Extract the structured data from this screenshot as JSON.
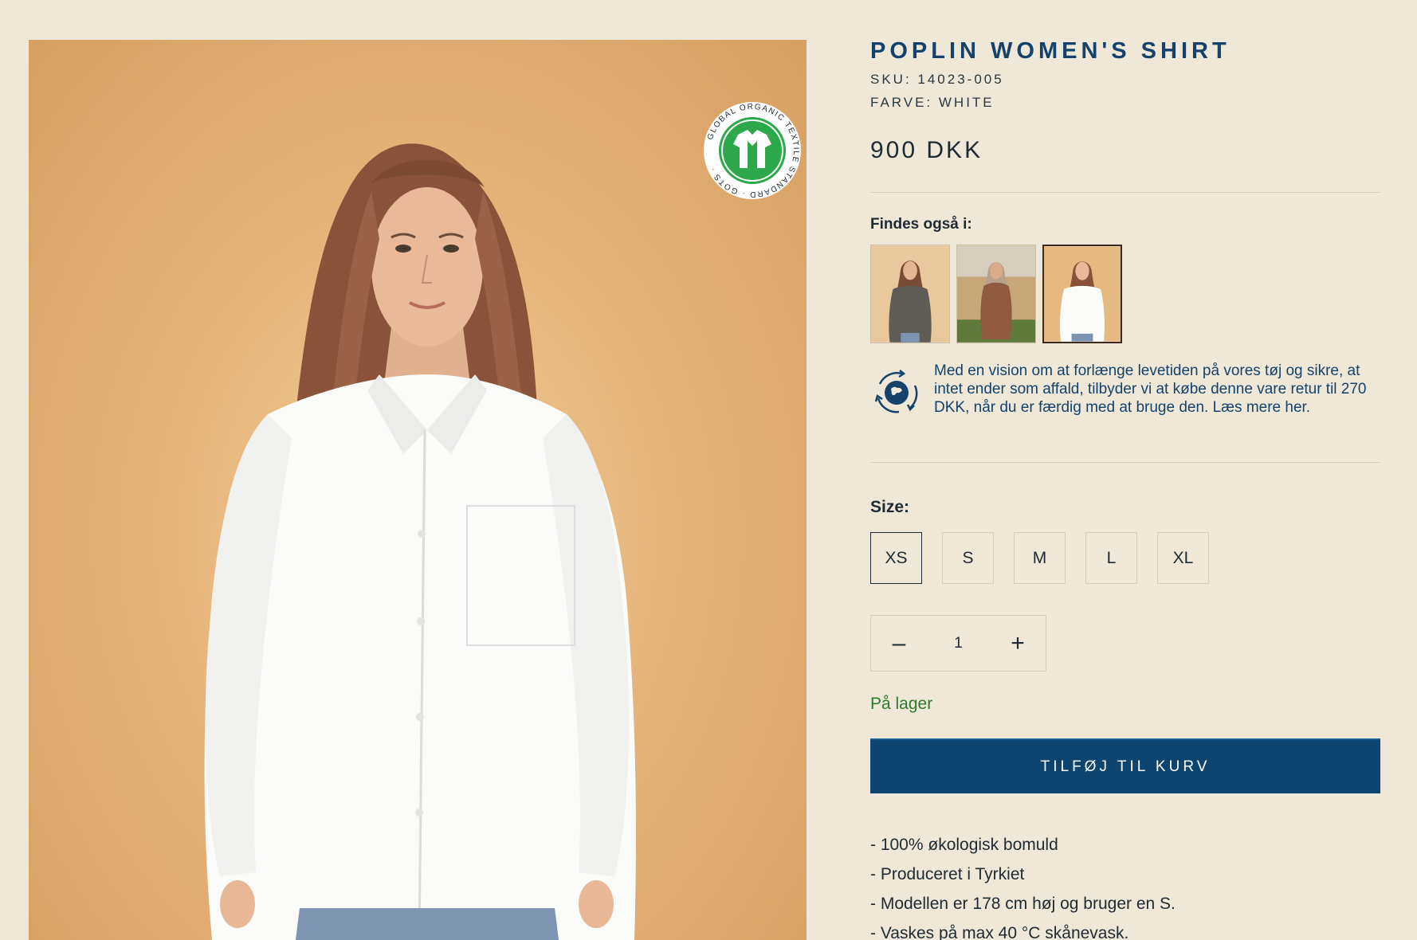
{
  "product": {
    "title": "POPLIN WOMEN'S SHIRT",
    "sku": "SKU: 14023-005",
    "color": "FARVE: WHITE",
    "price": "900 DKK"
  },
  "badge": {
    "text": "GLOBAL ORGANIC TEXTILE STANDARD · GOTS ·",
    "icon": "gots-shirt-icon"
  },
  "variants": {
    "label": "Findes også i:",
    "items": [
      {
        "name": "variant-grey-shirt",
        "active": false
      },
      {
        "name": "variant-brown-shirt",
        "active": false
      },
      {
        "name": "variant-white-shirt",
        "active": true
      }
    ]
  },
  "buyback": {
    "icon": "recycle-globe-icon",
    "text": "Med en vision om at forlænge levetiden på vores tøj og sikre, at intet ender som affald, tilbyder vi at købe denne vare retur til 270 DKK, når du er færdig med at bruge den. Læs mere her."
  },
  "size": {
    "label": "Size:",
    "options": [
      "XS",
      "S",
      "M",
      "L",
      "XL"
    ],
    "selected": "XS"
  },
  "quantity": {
    "minus": "–",
    "value": "1",
    "plus": "+"
  },
  "stock": "På lager",
  "add_to_cart": "TILFØJ TIL KURV",
  "features": [
    "- 100% økologisk bomuld",
    "- Produceret i Tyrkiet",
    "- Modellen er 178 cm høj og bruger en S.",
    "- Vaskes på max 40 °C skånevask."
  ],
  "colors": {
    "background": "#efe8d9",
    "brand_blue": "#0d4470",
    "title_blue": "#15426a",
    "stock_green": "#2c7a2c",
    "gots_green": "#2da84a"
  }
}
